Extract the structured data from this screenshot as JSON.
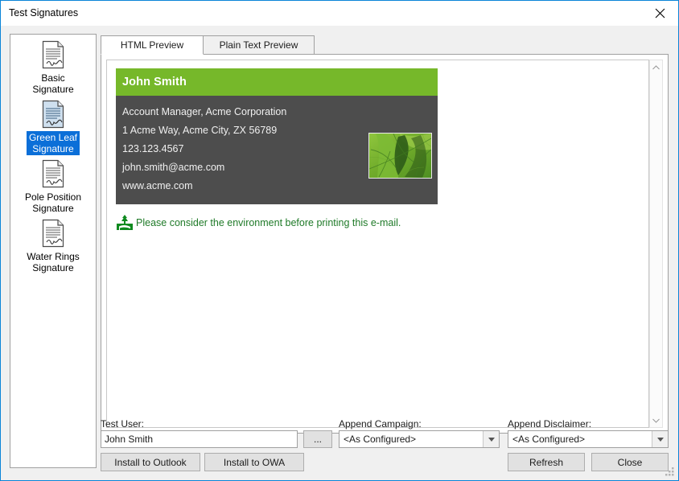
{
  "window": {
    "title": "Test Signatures",
    "close_icon": "close-icon"
  },
  "sidebar": {
    "items": [
      {
        "label": "Basic\nSignature",
        "icon": "document-signature-icon",
        "selected": false
      },
      {
        "label": "Green Leaf\nSignature",
        "icon": "document-signature-icon",
        "selected": true
      },
      {
        "label": "Pole Position\nSignature",
        "icon": "document-signature-icon",
        "selected": false
      },
      {
        "label": "Water Rings\nSignature",
        "icon": "document-signature-icon",
        "selected": false
      }
    ]
  },
  "tabs": [
    {
      "label": "HTML Preview",
      "active": true
    },
    {
      "label": "Plain Text Preview",
      "active": false
    }
  ],
  "preview": {
    "signature": {
      "name": "John Smith",
      "lines": [
        "Account Manager, Acme Corporation",
        "1 Acme Way, Acme City, ZX 56789",
        "123.123.4567",
        "john.smith@acme.com",
        "www.acme.com"
      ],
      "image_alt": "green-leaf-photo",
      "header_color": "#76b82a",
      "body_color": "#4d4d4d"
    },
    "eco_notice": {
      "icon": "green-tree-icon",
      "text": "Please consider the environment before printing this e-mail.",
      "color": "#1f7a28"
    },
    "scrollbar": {
      "up_icon": "chevron-up-icon",
      "down_icon": "chevron-down-icon"
    }
  },
  "footer": {
    "test_user_label": "Test User:",
    "test_user_value": "John Smith",
    "test_user_placeholder": "",
    "browse_label": "...",
    "install_outlook_label": "Install to Outlook",
    "install_owa_label": "Install to OWA",
    "append_campaign_label": "Append Campaign:",
    "append_campaign_value": "<As Configured>",
    "append_disclaimer_label": "Append Disclaimer:",
    "append_disclaimer_value": "<As Configured>",
    "refresh_label": "Refresh",
    "close_label": "Close",
    "dropdown_icon": "chevron-down-icon",
    "resize_grip_icon": "resize-grip-icon"
  },
  "colors": {
    "accent": "#0b6fd8",
    "window_border": "#0a84d8",
    "brand_green": "#76b82a",
    "eco_green": "#1f7a28"
  }
}
